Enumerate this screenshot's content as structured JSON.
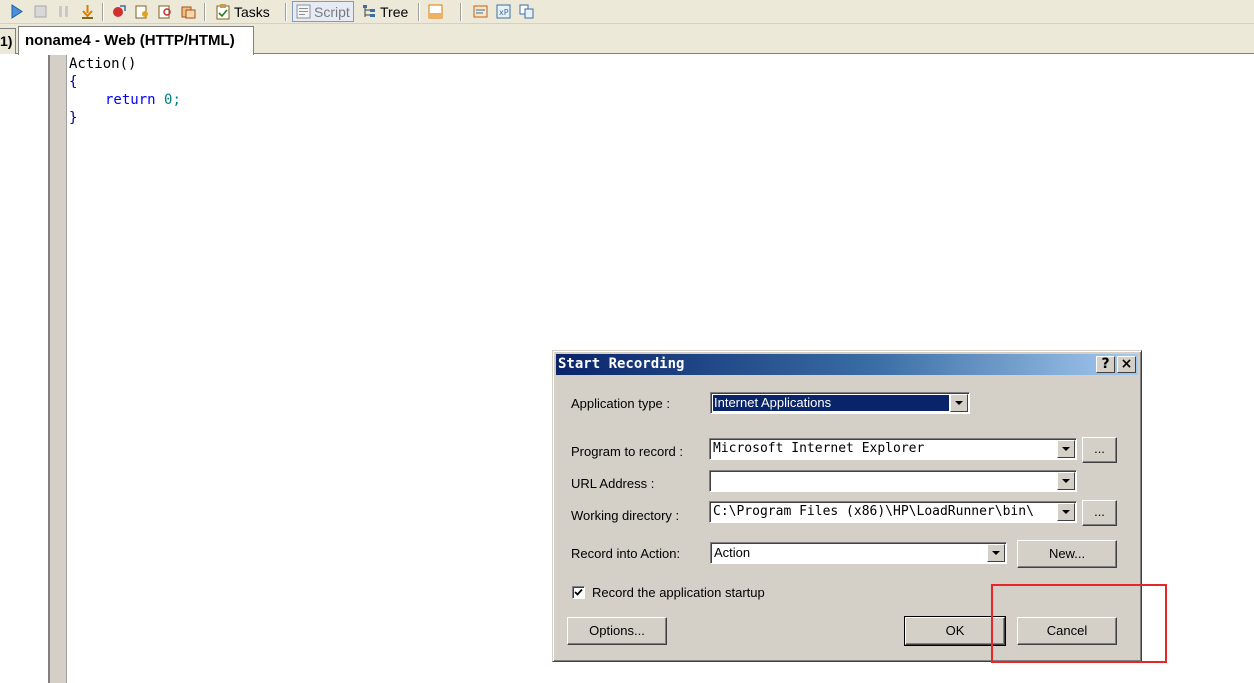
{
  "toolbar": {
    "tasks_label": "Tasks",
    "script_label": "Script",
    "tree_label": "Tree"
  },
  "tabs": {
    "prev_label": "1)",
    "active_label": "noname4 - Web (HTTP/HTML)"
  },
  "code": {
    "line1": "Action()",
    "line2": "{",
    "line3_kw": "return",
    "line3_num": "0",
    "line3_end": ";",
    "line4": "}"
  },
  "dialog": {
    "title": "Start Recording",
    "help_label": "?",
    "close_label": "×",
    "app_type_label": "Application type :",
    "app_type_value": "Internet Applications",
    "program_label": "Program to record :",
    "program_value": "Microsoft Internet Explorer",
    "url_label": "URL Address :",
    "url_value": "",
    "workdir_label": "Working directory :",
    "workdir_value": "C:\\Program Files (x86)\\HP\\LoadRunner\\bin\\",
    "record_into_label": "Record into Action:",
    "record_into_value": "Action",
    "browse_label": "...",
    "new_label": "New...",
    "startup_label": "Record the application startup",
    "startup_checked": true,
    "options_label": "Options...",
    "ok_label": "OK",
    "cancel_label": "Cancel"
  },
  "colors": {
    "titlebar_start": "#0a246a",
    "titlebar_end": "#a6caf0",
    "highlight": "#e8262a",
    "keyword": "#0000ff",
    "number": "#008080"
  }
}
